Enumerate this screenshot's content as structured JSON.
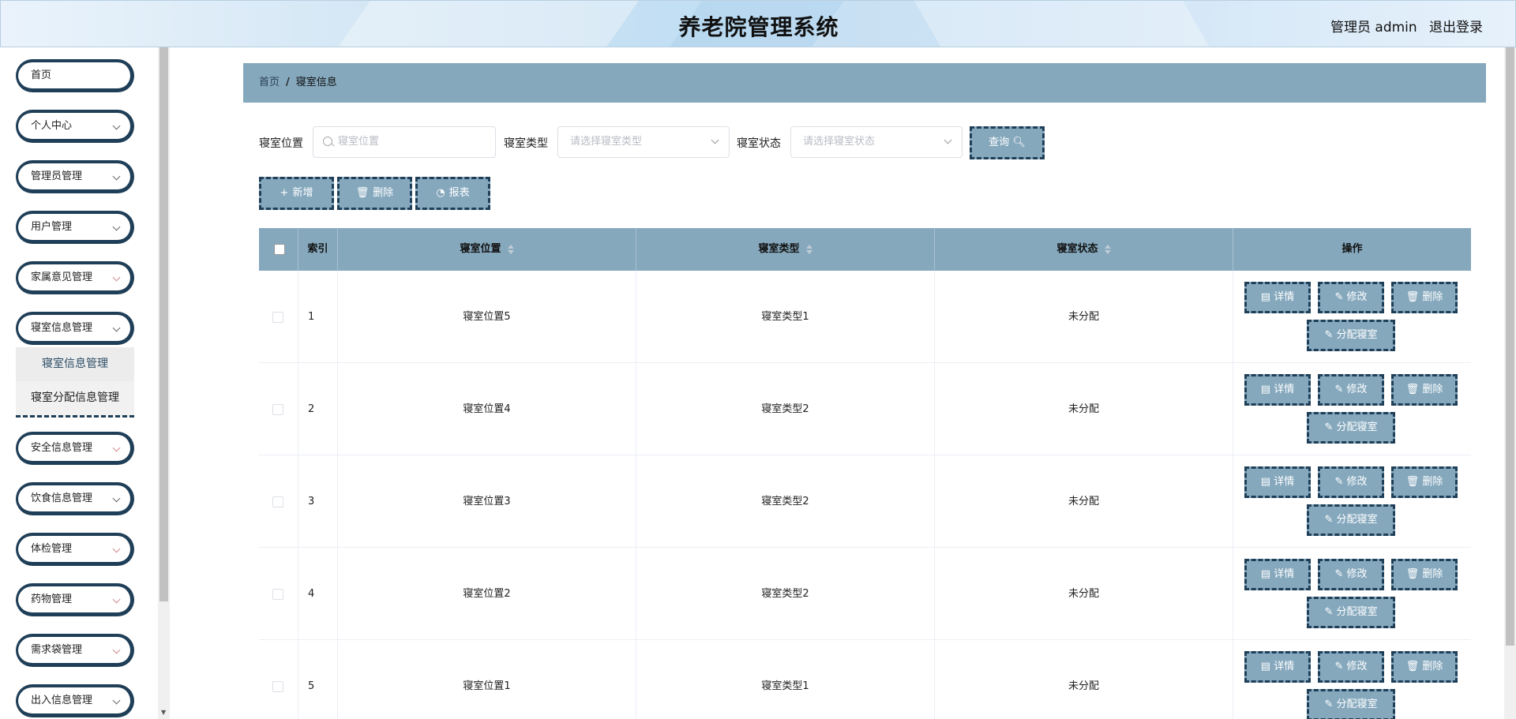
{
  "header": {
    "title": "养老院管理系统",
    "user": "管理员 admin",
    "logout": "退出登录"
  },
  "sidebar": {
    "items": [
      {
        "label": "首页"
      },
      {
        "label": "个人中心"
      },
      {
        "label": "管理员管理"
      },
      {
        "label": "用户管理"
      },
      {
        "label": "家属意见管理"
      },
      {
        "label": "寝室信息管理"
      },
      {
        "label": "安全信息管理"
      },
      {
        "label": "饮食信息管理"
      },
      {
        "label": "体检管理"
      },
      {
        "label": "药物管理"
      },
      {
        "label": "需求袋管理"
      },
      {
        "label": "出入信息管理"
      }
    ],
    "submenu": [
      "寝室信息管理",
      "寝室分配信息管理"
    ]
  },
  "breadcrumb": {
    "home": "首页",
    "separator": "/",
    "current": "寝室信息"
  },
  "search": {
    "location_label": "寝室位置",
    "location_placeholder": "寝室位置",
    "type_label": "寝室类型",
    "type_placeholder": "请选择寝室类型",
    "status_label": "寝室状态",
    "status_placeholder": "请选择寝室状态",
    "query_button": "查询"
  },
  "toolbar": {
    "add": "新增",
    "delete": "删除",
    "report": "报表"
  },
  "table": {
    "headers": {
      "index": "索引",
      "location": "寝室位置",
      "type": "寝室类型",
      "status": "寝室状态",
      "actions": "操作"
    },
    "rows": [
      {
        "index": "1",
        "location": "寝室位置5",
        "type": "寝室类型1",
        "status": "未分配"
      },
      {
        "index": "2",
        "location": "寝室位置4",
        "type": "寝室类型2",
        "status": "未分配"
      },
      {
        "index": "3",
        "location": "寝室位置3",
        "type": "寝室类型2",
        "status": "未分配"
      },
      {
        "index": "4",
        "location": "寝室位置2",
        "type": "寝室类型2",
        "status": "未分配"
      },
      {
        "index": "5",
        "location": "寝室位置1",
        "type": "寝室类型1",
        "status": "未分配"
      }
    ],
    "actions": {
      "detail": "详情",
      "edit": "修改",
      "delete": "删除",
      "assign": "分配寝室"
    }
  }
}
